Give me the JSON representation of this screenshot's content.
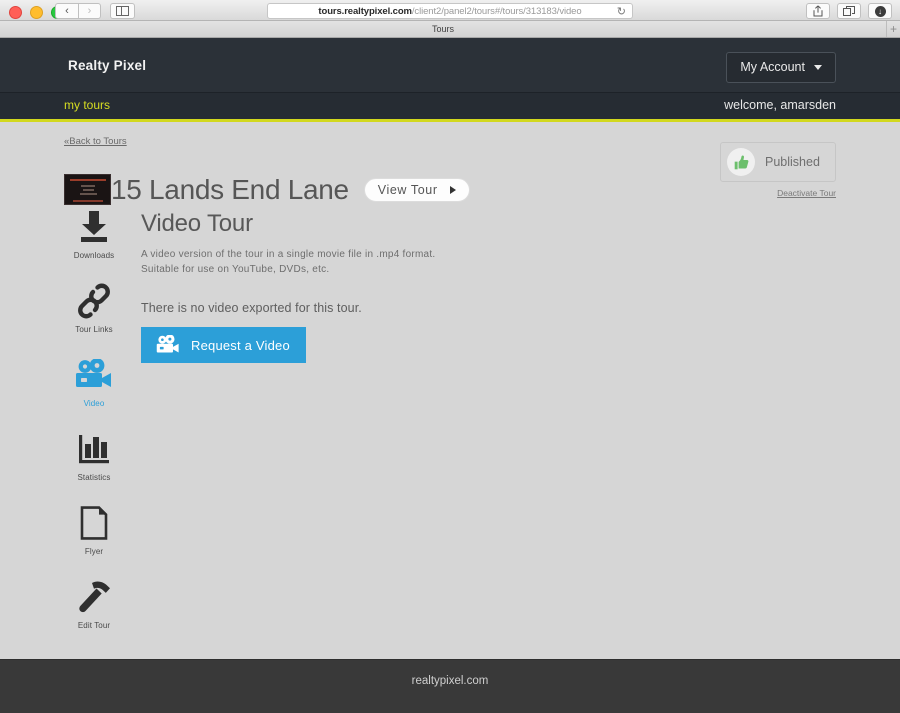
{
  "browser": {
    "url_bold": "tours.realtypixel.com",
    "url_rest": "/client2/panel2/tours#/tours/313183/video",
    "reload_icon": "reload-icon",
    "back_icon": "chevron-left-icon",
    "forward_icon": "chevron-right-icon",
    "sidebar_icon": "sidebar-toggle-icon",
    "share_icon": "share-icon",
    "tabs_icon": "show-tabs-icon",
    "downloads_icon": "downloads-icon",
    "tab_title": "Tours",
    "new_tab_label": "+"
  },
  "header": {
    "brand": "Realty Pixel",
    "account_label": "My Account",
    "account_caret_icon": "caret-down-icon"
  },
  "subnav": {
    "my_tours": "my tours",
    "welcome": "welcome, amarsden",
    "accent_color": "#d2d81e"
  },
  "content": {
    "back_link": "«Back to Tours",
    "tour_title": "15 Lands End Lane",
    "thumbnail_icon": "tour-thumbnail",
    "view_tour_label": "View Tour",
    "view_tour_icon": "play-triangle-icon",
    "status_label": "Published",
    "status_icon": "thumbs-up-icon",
    "status_color": "#6cbf6c",
    "deactivate_label": "Deactivate Tour"
  },
  "sidebar": {
    "items": [
      {
        "label": "Downloads",
        "icon": "download-icon",
        "active": false
      },
      {
        "label": "Tour Links",
        "icon": "link-chain-icon",
        "active": false
      },
      {
        "label": "Video",
        "icon": "movie-camera-icon",
        "active": true
      },
      {
        "label": "Statistics",
        "icon": "bar-chart-icon",
        "active": false
      },
      {
        "label": "Flyer",
        "icon": "document-page-icon",
        "active": false
      },
      {
        "label": "Edit Tour",
        "icon": "hammer-icon",
        "active": false
      }
    ],
    "active_color": "#2c9fd8"
  },
  "panel": {
    "title": "Video Tour",
    "description_line1": "A video version of the tour in a single movie file in .mp4 format.",
    "description_line2": "Suitable for use on YouTube, DVDs, etc.",
    "empty_message": "There is no video exported for this tour.",
    "request_button_label": "Request a Video",
    "request_button_icon": "movie-camera-icon",
    "request_button_color": "#2c9fd8"
  },
  "footer": {
    "text": "realtypixel.com"
  }
}
